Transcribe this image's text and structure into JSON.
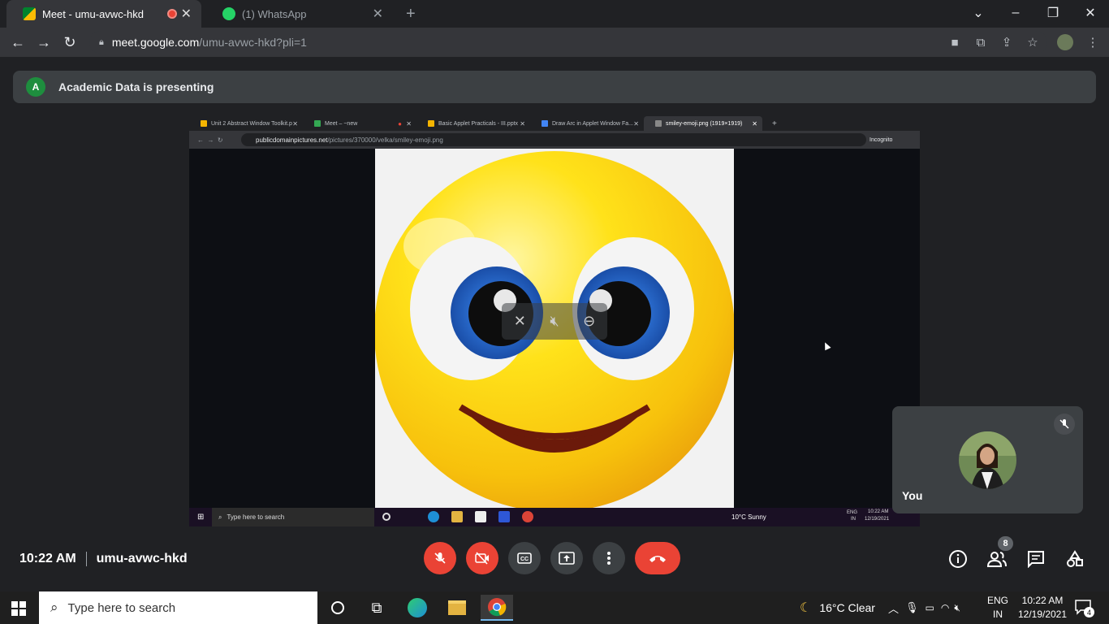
{
  "browser": {
    "tabs": [
      {
        "title": "Meet - umu-avwc-hkd",
        "active": true,
        "recording": true
      },
      {
        "title": "(1) WhatsApp",
        "active": false
      }
    ],
    "new_tab": "+",
    "window_controls": {
      "minimize": "–",
      "restore": "❐",
      "close": "✕"
    },
    "url_host": "meet.google.com",
    "url_path": "/umu-avwc-hkd?pli=1"
  },
  "meet": {
    "presenter_initial": "A",
    "presenting_text": "Academic Data is presenting",
    "time": "10:22 AM",
    "meeting_code": "umu-avwc-hkd",
    "self_name": "You",
    "participants_count": "8"
  },
  "shared_screen": {
    "tabs": [
      "Unit 2 Abstract Window Toolkit.p",
      "Meet – ~new",
      "Basic Applet Practicals - III.pptx",
      "Draw Arc in Applet Window Fa...",
      "smiley-emoji.png (1919×1919)"
    ],
    "url_host": "publicdomainpictures.net",
    "url_path": "/pictures/370000/velka/smiley-emoji.png",
    "incognito_label": "Incognito",
    "taskbar_search": "Type here to search",
    "weather": "10°C  Sunny",
    "lang_top": "ENG",
    "lang_bottom": "IN",
    "time": "10:22 AM",
    "date": "12/19/2021"
  },
  "taskbar": {
    "search_placeholder": "Type here to search",
    "weather": "16°C  Clear",
    "lang_top": "ENG",
    "lang_bottom": "IN",
    "time": "10:22 AM",
    "date": "12/19/2021",
    "notification_count": "4"
  },
  "colors": {
    "end_call": "#ea4335",
    "meet_bg": "#202124",
    "tile_bg": "#3c4043"
  }
}
